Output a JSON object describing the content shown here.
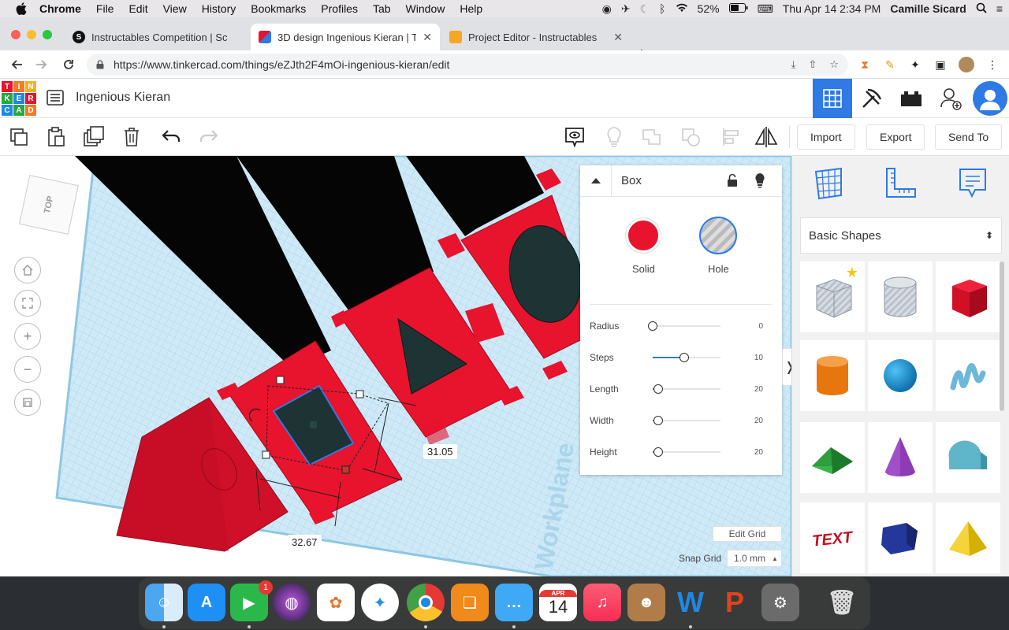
{
  "menubar": {
    "app": "Chrome",
    "items": [
      "File",
      "Edit",
      "View",
      "History",
      "Bookmarks",
      "Profiles",
      "Tab",
      "Window",
      "Help"
    ],
    "battery": "52%",
    "datetime": "Thu Apr 14  2:34 PM",
    "user": "Camille Sicard"
  },
  "tabs": [
    {
      "title": "Instructables Competition | Sc",
      "favicon": "S"
    },
    {
      "title": "3D design Ingenious Kieran | T",
      "favicon": "T"
    },
    {
      "title": "Project Editor - Instructables",
      "favicon": "I"
    }
  ],
  "address": {
    "url": "https://www.tinkercad.com/things/eZJth2F4mOi-ingenious-kieran/edit"
  },
  "tinkercad": {
    "logo_letters": [
      "T",
      "I",
      "N",
      "K",
      "E",
      "R",
      "C",
      "A",
      "D"
    ],
    "project_title": "Ingenious Kieran",
    "import_label": "Import",
    "export_label": "Export",
    "sendto_label": "Send To"
  },
  "workplane": {
    "viewcube_label": "TOP",
    "watermark": "Workplane",
    "dim_width": "32.67",
    "dim_depth": "31.05",
    "edit_grid_label": "Edit Grid",
    "snap_grid_label": "Snap Grid",
    "snap_grid_value": "1.0 mm"
  },
  "inspector": {
    "title": "Box",
    "solid_label": "Solid",
    "hole_label": "Hole",
    "solid_color": "#e8132d",
    "props": [
      {
        "name": "Radius",
        "value": "0",
        "fraction": 0.0
      },
      {
        "name": "Steps",
        "value": "10",
        "fraction": 0.47
      },
      {
        "name": "Length",
        "value": "20",
        "fraction": 0.08
      },
      {
        "name": "Width",
        "value": "20",
        "fraction": 0.08
      },
      {
        "name": "Height",
        "value": "20",
        "fraction": 0.08
      }
    ]
  },
  "library": {
    "selected": "Basic Shapes",
    "shapes": [
      "box-hole",
      "cylinder-hole",
      "box",
      "cylinder",
      "sphere",
      "scribble",
      "roof",
      "cone",
      "round-roof",
      "text",
      "polygon",
      "pyramid"
    ]
  },
  "colors": {
    "accent": "#2f7ae5",
    "shape_red": "#e8132d",
    "hole_dark": "#1e3333"
  },
  "dock": {
    "facetime_badge": "1",
    "calendar_month": "APR",
    "calendar_day": "14"
  }
}
